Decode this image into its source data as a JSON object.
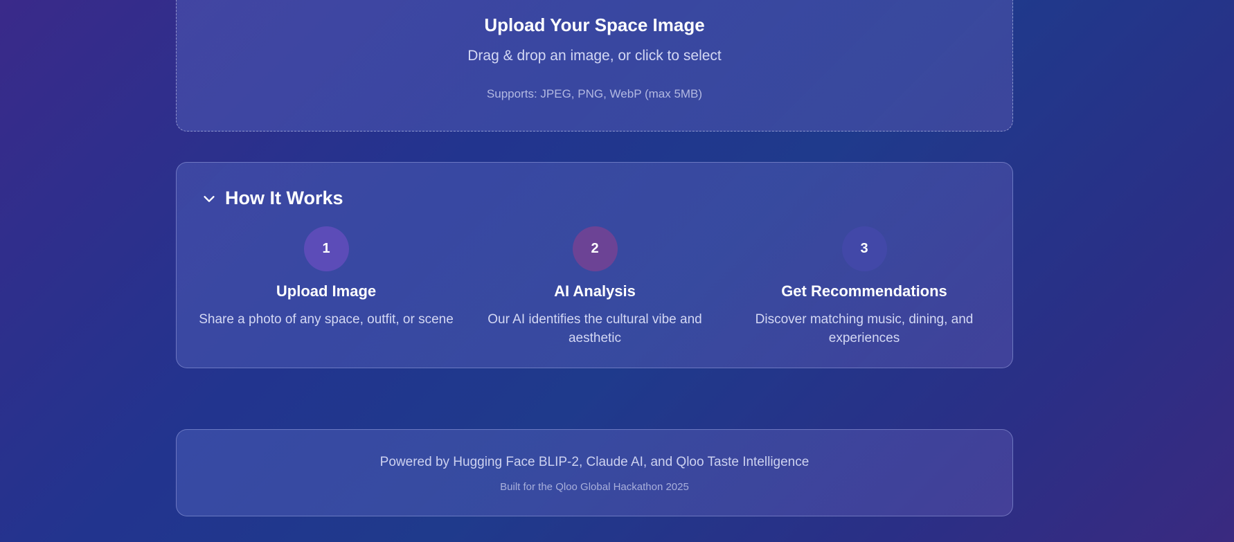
{
  "upload": {
    "title": "Upload Your Space Image",
    "subtitle": "Drag & drop an image, or click to select",
    "formats": "Supports: JPEG, PNG, WebP (max 5MB)"
  },
  "how_it_works": {
    "title": "How It Works",
    "steps": [
      {
        "number": "1",
        "title": "Upload Image",
        "description": "Share a photo of any space, outfit, or scene",
        "color": "#5c4cb8"
      },
      {
        "number": "2",
        "title": "AI Analysis",
        "description": "Our AI identifies the cultural vibe and aesthetic",
        "color": "#6c4395"
      },
      {
        "number": "3",
        "title": "Get Recommendations",
        "description": "Discover matching music, dining, and experiences",
        "color": "#4248a8"
      }
    ]
  },
  "footer": {
    "powered_by": "Powered by Hugging Face BLIP-2, Claude AI, and Qloo Taste Intelligence",
    "built_for": "Built for the Qloo Global Hackathon 2025"
  }
}
